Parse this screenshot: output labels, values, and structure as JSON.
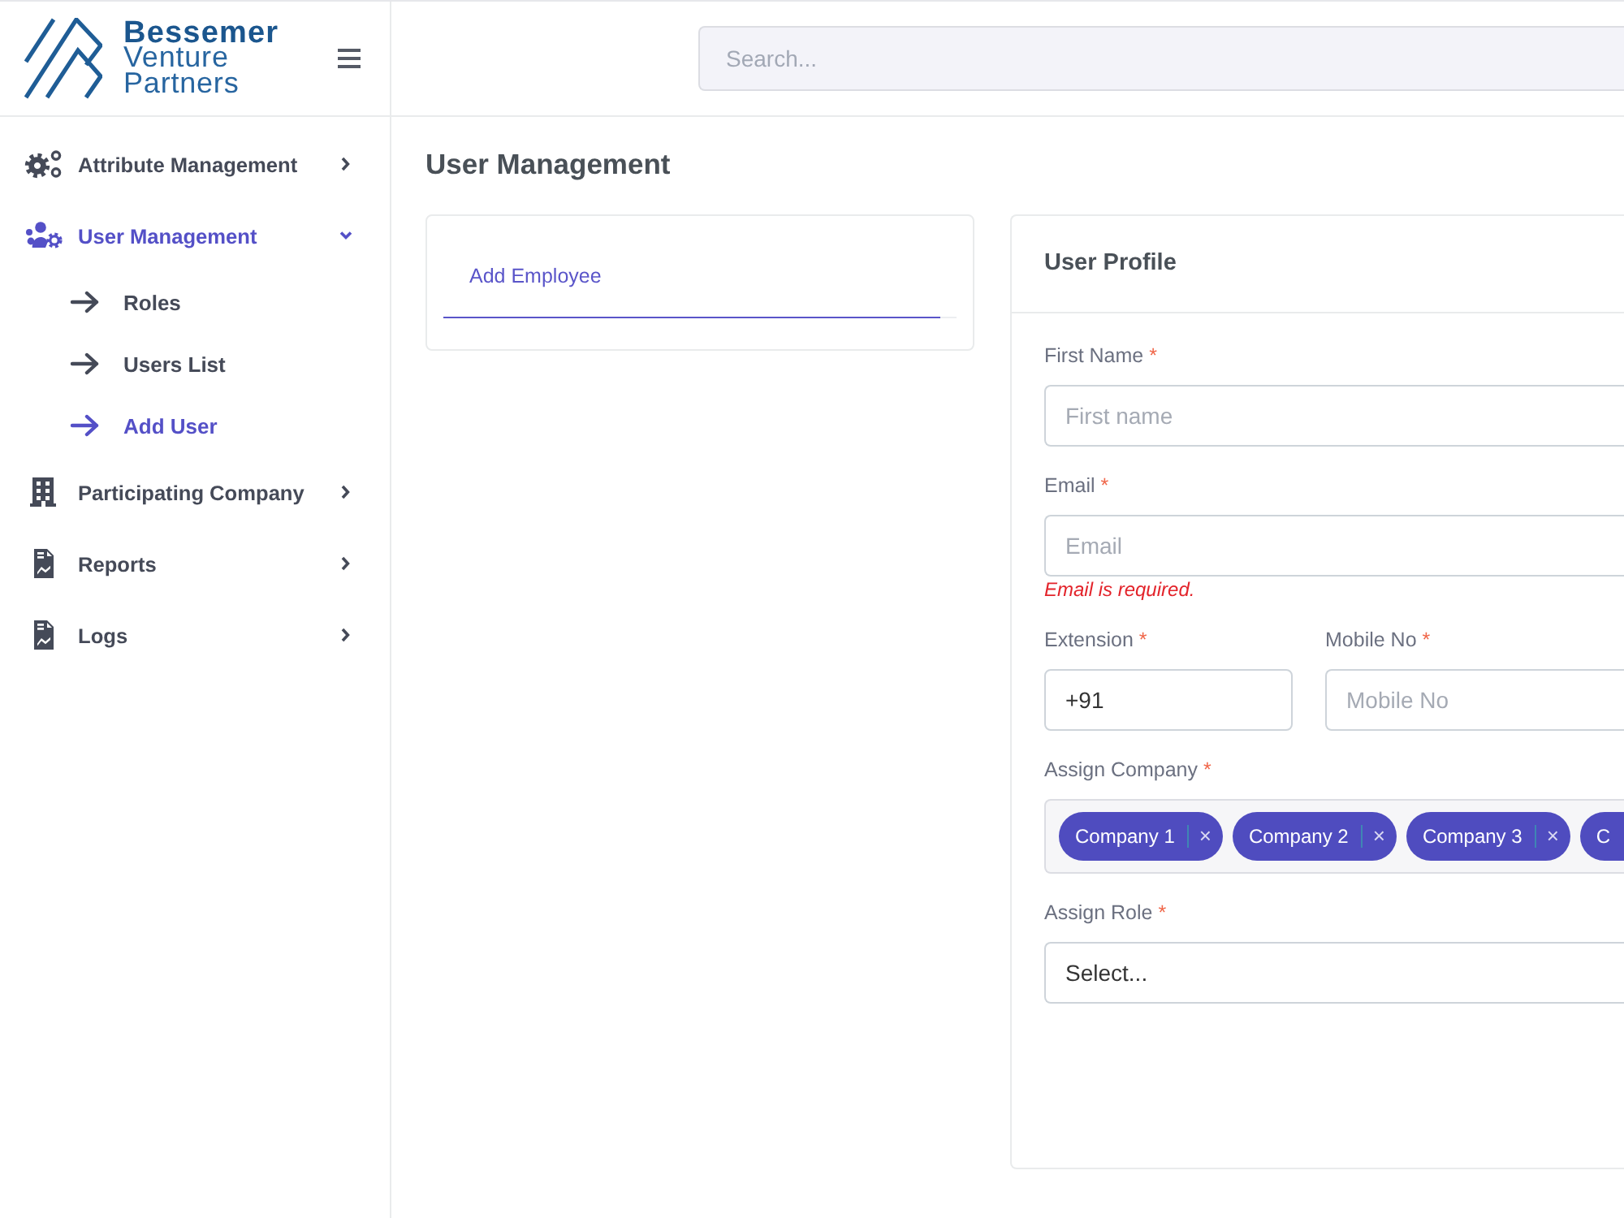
{
  "sidebar": {
    "logo": {
      "lines": [
        "Bessemer",
        "Venture",
        "Partners"
      ]
    },
    "items": [
      {
        "label": "Attribute Management",
        "selected": false,
        "expanded": false
      },
      {
        "label": "User Management",
        "selected": true,
        "expanded": true,
        "children": [
          {
            "label": "Roles",
            "selected": false
          },
          {
            "label": "Users List",
            "selected": false
          },
          {
            "label": "Add User",
            "selected": true
          }
        ]
      },
      {
        "label": "Participating Company",
        "selected": false,
        "expanded": false
      },
      {
        "label": "Reports",
        "selected": false,
        "expanded": false
      },
      {
        "label": "Logs",
        "selected": false,
        "expanded": false
      }
    ]
  },
  "header": {
    "search": {
      "placeholder": "Search..."
    }
  },
  "page_title": "User Management",
  "employee_card": {
    "tabs": [
      {
        "label": "Add Employee",
        "selected": true
      }
    ]
  },
  "profile_card": {
    "title": "User Profile",
    "fields": [
      {
        "kind": "input",
        "label": "First Name",
        "required_mark": "*",
        "placeholder": "First name"
      },
      {
        "kind": "input",
        "label": "Email",
        "required_mark": "*",
        "placeholder": "Email",
        "error": "Email is required."
      },
      {
        "kind": "row",
        "fields": [
          {
            "kind": "input",
            "label": "Extension",
            "required_mark": "*",
            "value": "+91"
          },
          {
            "kind": "input",
            "label": "Mobile No",
            "required_mark": "*",
            "placeholder": "Mobile No"
          }
        ]
      },
      {
        "kind": "tags",
        "label": "Assign Company",
        "required_mark": "*",
        "tags": [
          {
            "label": "Company 1",
            "remove": "×"
          },
          {
            "label": "Company 2",
            "remove": "×"
          },
          {
            "label": "Company 3",
            "remove": "×"
          },
          {
            "label": "C"
          }
        ]
      },
      {
        "kind": "select",
        "label": "Assign Role",
        "required_mark": "*",
        "placeholder": "Select..."
      }
    ]
  }
}
